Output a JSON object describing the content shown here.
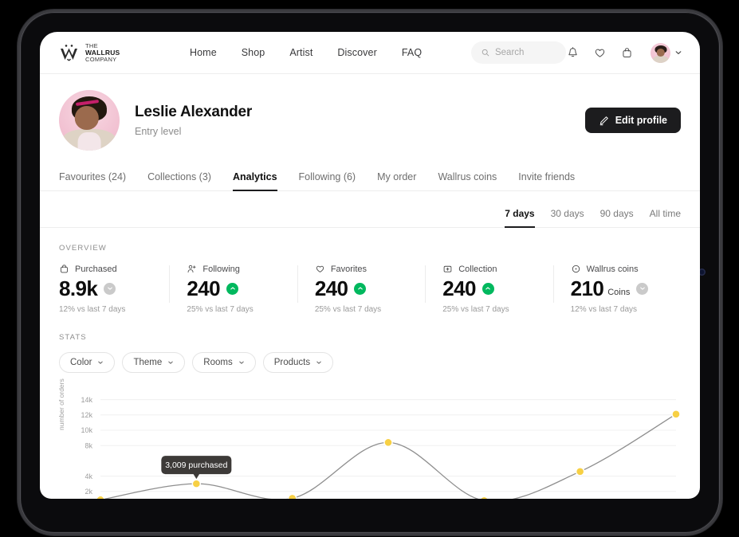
{
  "brand": {
    "line1": "THE",
    "line2_bold": "WALLRUS",
    "line3": "COMPANY",
    "logo_icon": "walrus-w-icon"
  },
  "nav": {
    "links": [
      {
        "label": "Home"
      },
      {
        "label": "Shop"
      },
      {
        "label": "Artist"
      },
      {
        "label": "Discover"
      },
      {
        "label": "FAQ"
      }
    ],
    "search": {
      "placeholder": "Search",
      "value": "",
      "icon": "search-icon"
    },
    "icons": [
      {
        "name": "bell-icon"
      },
      {
        "name": "heart-icon"
      },
      {
        "name": "shopping-bag-icon"
      }
    ],
    "avatar_chevron": "chevron-down-icon"
  },
  "profile": {
    "name": "Leslie Alexander",
    "level": "Entry level",
    "edit_label": "Edit profile",
    "edit_icon": "pencil-icon"
  },
  "tabs": [
    {
      "label": "Favourites (24)",
      "active": false
    },
    {
      "label": "Collections (3)",
      "active": false
    },
    {
      "label": "Analytics",
      "active": true
    },
    {
      "label": "Following (6)",
      "active": false
    },
    {
      "label": "My order",
      "active": false
    },
    {
      "label": "Wallrus coins",
      "active": false
    },
    {
      "label": "Invite friends",
      "active": false
    }
  ],
  "ranges": [
    {
      "label": "7 days",
      "active": true
    },
    {
      "label": "30 days",
      "active": false
    },
    {
      "label": "90 days",
      "active": false
    },
    {
      "label": "All time",
      "active": false
    }
  ],
  "overview": {
    "label": "OVERVIEW",
    "cards": [
      {
        "title": "Purchased",
        "icon": "shopping-bag-icon",
        "value": "8.9k",
        "unit": "",
        "trend": "down",
        "delta": "12% vs last 7 days"
      },
      {
        "title": "Following",
        "icon": "user-plus-icon",
        "value": "240",
        "unit": "",
        "trend": "up",
        "delta": "25% vs last 7 days"
      },
      {
        "title": "Favorites",
        "icon": "heart-icon",
        "value": "240",
        "unit": "",
        "trend": "up",
        "delta": "25% vs last 7 days"
      },
      {
        "title": "Collection",
        "icon": "folder-plus-icon",
        "value": "240",
        "unit": "",
        "trend": "up",
        "delta": "25% vs last 7 days"
      },
      {
        "title": "Wallrus coins",
        "icon": "coin-icon",
        "value": "210",
        "unit": "Coins",
        "trend": "down",
        "delta": "12% vs last 7 days"
      }
    ]
  },
  "stats": {
    "label": "STATS",
    "filters": [
      {
        "label": "Color",
        "icon": "chevron-down-icon"
      },
      {
        "label": "Theme",
        "icon": "chevron-down-icon"
      },
      {
        "label": "Rooms",
        "icon": "chevron-down-icon"
      },
      {
        "label": "Products",
        "icon": "chevron-down-icon"
      }
    ],
    "tooltip": {
      "text": "3,009 purchased"
    }
  },
  "colors": {
    "accent_point": "#f7d044",
    "line": "#8e8e8e",
    "trend_up": "#00b85e",
    "trend_down": "#cacaca",
    "dark": "#1c1c1e",
    "tooltip_bg": "#3d3a38"
  },
  "chart_data": {
    "type": "line",
    "title": "",
    "xlabel": "",
    "ylabel": "number of orders",
    "ylim": [
      0,
      15000
    ],
    "ytick_labels": [
      "2k",
      "4k",
      "8k",
      "10k",
      "12k",
      "14k"
    ],
    "ytick_values": [
      2000,
      4000,
      8000,
      10000,
      12000,
      14000
    ],
    "grid": true,
    "legend": "none",
    "x": [
      1,
      2,
      3,
      4,
      5,
      6,
      7
    ],
    "series": [
      {
        "name": "purchased",
        "values": [
          900,
          3009,
          1100,
          8400,
          800,
          4600,
          12100
        ]
      }
    ],
    "highlight_index": 1,
    "highlight_label": "3,009 purchased"
  }
}
